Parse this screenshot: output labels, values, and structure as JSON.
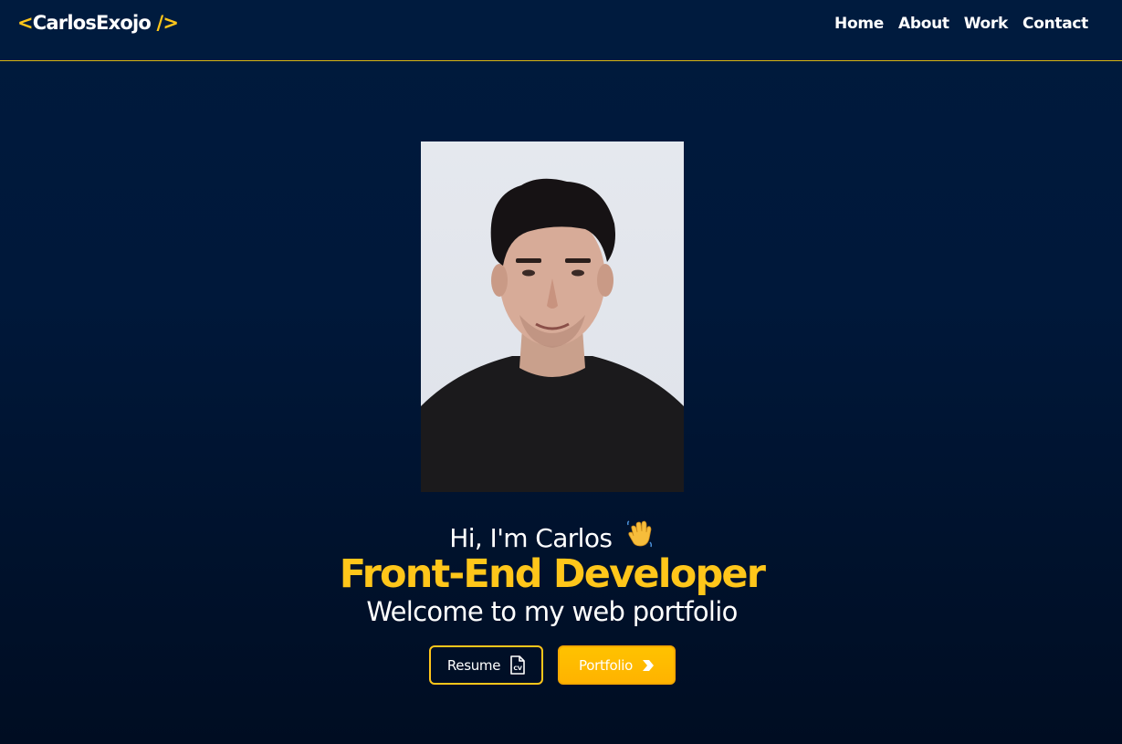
{
  "header": {
    "logo": {
      "open_bracket": "<",
      "name": "CarlosExojo",
      "close_bracket": "/>"
    },
    "nav": [
      {
        "label": "Home"
      },
      {
        "label": "About"
      },
      {
        "label": "Work"
      },
      {
        "label": "Contact"
      }
    ]
  },
  "hero": {
    "photo_alt": "Carlos",
    "greeting": "Hi, I'm Carlos",
    "role": "Front-End Developer",
    "welcome": "Welcome to my web portfolio",
    "buttons": {
      "resume": "Resume",
      "portfolio": "Portfolio"
    }
  },
  "icons": {
    "wave": "waving-hand-icon",
    "resume": "cv-file-icon",
    "portfolio": "chevron-right-icon"
  },
  "colors": {
    "accent": "#ffc61a",
    "background": "#001a3d",
    "text": "#ffffff"
  }
}
